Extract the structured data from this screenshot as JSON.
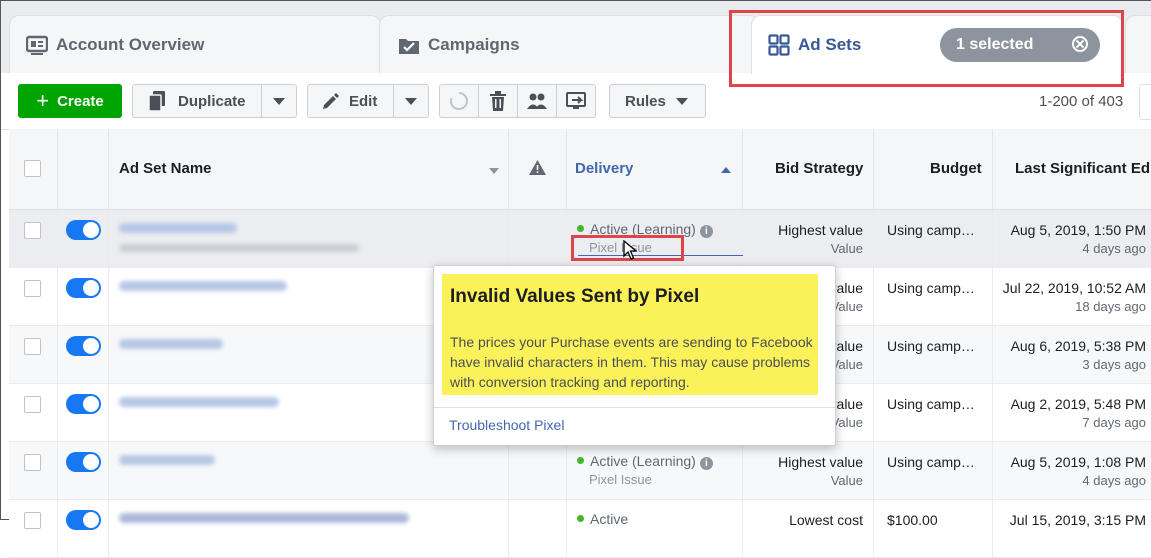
{
  "tabs": {
    "account_overview": "Account Overview",
    "campaigns": "Campaigns",
    "ad_sets": "Ad Sets",
    "selected_count": "1 selected"
  },
  "toolbar": {
    "create": "Create",
    "duplicate": "Duplicate",
    "edit": "Edit",
    "rules": "Rules",
    "pagination": "1-200 of 403"
  },
  "columns": {
    "name": "Ad Set Name",
    "delivery": "Delivery",
    "bid_strategy": "Bid Strategy",
    "budget": "Budget",
    "last_edit": "Last Significant Ed"
  },
  "rows": [
    {
      "delivery": "Active (Learning)",
      "delivery_sub": "Pixel Issue",
      "bid": "Highest value",
      "bid_sub": "Value",
      "budget": "Using camp…",
      "edit_date": "Aug 5, 2019, 1:50 PM",
      "edit_ago": "4 days ago"
    },
    {
      "delivery": "",
      "delivery_sub": "",
      "bid": "Highest value",
      "bid_sub": "Value",
      "budget": "Using camp…",
      "edit_date": "Jul 22, 2019, 10:52 AM",
      "edit_ago": "18 days ago"
    },
    {
      "delivery": "",
      "delivery_sub": "",
      "bid": "Highest value",
      "bid_sub": "Value",
      "budget": "Using camp…",
      "edit_date": "Aug 6, 2019, 5:38 PM",
      "edit_ago": "3 days ago"
    },
    {
      "delivery": "",
      "delivery_sub": "",
      "bid": "Highest value",
      "bid_sub": "Value",
      "budget": "Using camp…",
      "edit_date": "Aug 2, 2019, 5:48 PM",
      "edit_ago": "7 days ago"
    },
    {
      "delivery": "",
      "delivery_sub": "",
      "bid": "Highest value",
      "bid_sub": "Value",
      "budget": "Using camp…",
      "edit_date": "Aug 5, 2019, 1:08 PM",
      "edit_ago": "4 days ago"
    },
    {
      "delivery": "Active (Learning)",
      "delivery_sub": "Pixel Issue",
      "bid": "Highest value",
      "bid_sub": "Value",
      "budget": "Using camp…",
      "edit_date": "Aug 5, 2019, 1:08 PM",
      "edit_ago": "4 days ago"
    },
    {
      "delivery": "Active",
      "delivery_sub": "",
      "bid": "Lowest cost",
      "bid_sub": "",
      "budget": "$100.00",
      "edit_date": "Jul 15, 2019, 3:15 PM",
      "edit_ago": ""
    }
  ],
  "tooltip": {
    "title": "Invalid Values Sent by Pixel",
    "body": "The prices your Purchase events are sending to Facebook have invalid characters in them. This may cause problems with conversion tracking and reporting.",
    "link": "Troubleshoot Pixel"
  },
  "colors": {
    "create_green": "#00a400",
    "toggle_blue": "#1877f2",
    "highlight_yellow": "#fbf25a",
    "annotation_red": "#e0444b",
    "link_blue": "#4267b2"
  },
  "icons": [
    "account-overview-icon",
    "campaigns-folder-icon",
    "ad-sets-grid-icon",
    "close-circle-icon",
    "plus-icon",
    "duplicate-icon",
    "pencil-icon",
    "refresh-icon",
    "trash-icon",
    "audience-icon",
    "preview-icon",
    "warning-icon",
    "info-icon",
    "cursor-icon"
  ]
}
